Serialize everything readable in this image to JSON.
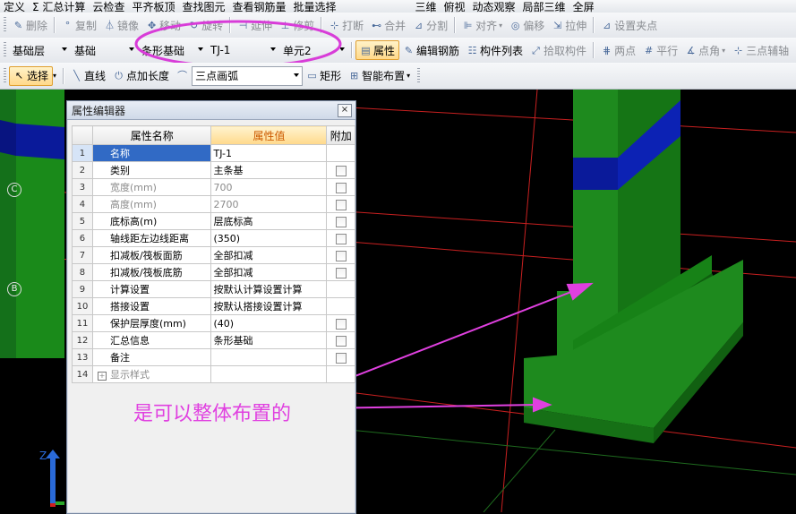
{
  "toolbar0": {
    "items": [
      "定义",
      "Σ 汇总计算",
      "云检查",
      "平齐板顶",
      "查找图元",
      "查看钢筋量",
      "批量选择",
      "三维",
      "俯视",
      "动态观察",
      "局部三维",
      "全屏"
    ]
  },
  "toolbar1": {
    "delete": "删除",
    "copy": "复制",
    "mirror": "镜像",
    "move": "移动",
    "rotate": "旋转",
    "extend": "延伸",
    "trim": "修剪",
    "break": "打断",
    "merge": "合并",
    "split": "分割",
    "align": "对齐",
    "offset": "偏移",
    "stretch": "拉伸",
    "set_grip": "设置夹点"
  },
  "toolbar2": {
    "floor": "基础层",
    "category": "基础",
    "component_type": "条形基础",
    "component": "TJ-1",
    "unit": "单元2",
    "properties": "属性",
    "edit_rebar": "编辑钢筋",
    "component_list": "构件列表",
    "pick": "拾取构件",
    "two_points": "两点",
    "parallel": "平行",
    "point_angle": "点角",
    "three_point_aux": "三点辅轴"
  },
  "toolbar3": {
    "select": "选择",
    "line": "直线",
    "point_length": "点加长度",
    "arc_mode": "三点画弧",
    "rect": "矩形",
    "smart_layout": "智能布置"
  },
  "prop_editor": {
    "title": "属性编辑器",
    "headers": {
      "name": "属性名称",
      "value": "属性值",
      "extra": "附加"
    },
    "rows": [
      {
        "num": "1",
        "name": "名称",
        "value": "TJ-1",
        "check": false,
        "selected": true,
        "gray": false
      },
      {
        "num": "2",
        "name": "类别",
        "value": "主条基",
        "check": true,
        "gray": false
      },
      {
        "num": "3",
        "name": "宽度(mm)",
        "value": "700",
        "check": true,
        "gray": true
      },
      {
        "num": "4",
        "name": "高度(mm)",
        "value": "2700",
        "check": true,
        "gray": true
      },
      {
        "num": "5",
        "name": "底标高(m)",
        "value": "层底标高",
        "check": true,
        "gray": false
      },
      {
        "num": "6",
        "name": "轴线距左边线距离",
        "value": "(350)",
        "check": true,
        "gray": false
      },
      {
        "num": "7",
        "name": "扣减板/筏板面筋",
        "value": "全部扣减",
        "check": true,
        "gray": false
      },
      {
        "num": "8",
        "name": "扣减板/筏板底筋",
        "value": "全部扣减",
        "check": true,
        "gray": false
      },
      {
        "num": "9",
        "name": "计算设置",
        "value": "按默认计算设置计算",
        "check": false,
        "gray": false
      },
      {
        "num": "10",
        "name": "搭接设置",
        "value": "按默认搭接设置计算",
        "check": false,
        "gray": false
      },
      {
        "num": "11",
        "name": "保护层厚度(mm)",
        "value": "(40)",
        "check": true,
        "gray": false
      },
      {
        "num": "12",
        "name": "汇总信息",
        "value": "条形基础",
        "check": true,
        "gray": false
      },
      {
        "num": "13",
        "name": "备注",
        "value": "",
        "check": true,
        "gray": false
      },
      {
        "num": "14",
        "name": "显示样式",
        "value": "",
        "check": false,
        "gray": true,
        "expand": true
      }
    ]
  },
  "viewport": {
    "annotation": "是可以整体布置的",
    "axis_label": "Z",
    "axis_marker_c": "C",
    "axis_marker_b": "B"
  },
  "colors": {
    "annotation": "#e040e0",
    "footing_green": "#1e8a1e",
    "band_blue": "#0a1a9a",
    "grid_red": "#c82020"
  }
}
